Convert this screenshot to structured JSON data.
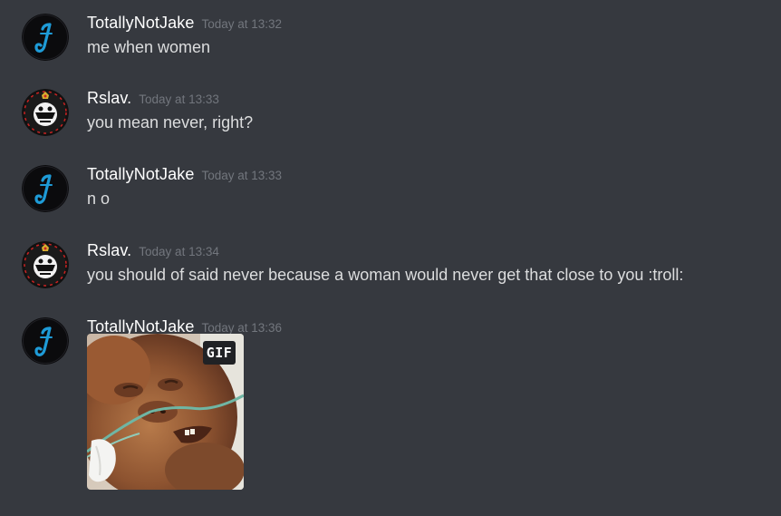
{
  "messages": [
    {
      "author": "TotallyNotJake",
      "avatar_icon": "blue-j-letter-avatar",
      "timestamp": "Today at 13:32",
      "content": "me when women"
    },
    {
      "author": "Rslav.",
      "avatar_icon": "black-white-emblem-avatar",
      "timestamp": "Today at 13:33",
      "content": "you mean never, right?"
    },
    {
      "author": "TotallyNotJake",
      "avatar_icon": "blue-j-letter-avatar",
      "timestamp": "Today at 13:33",
      "content": "n o"
    },
    {
      "author": "Rslav.",
      "avatar_icon": "black-white-emblem-avatar",
      "timestamp": "Today at 13:34",
      "content": "you should of said never because a woman would never get that close to you :troll:"
    },
    {
      "author": "TotallyNotJake",
      "avatar_icon": "blue-j-letter-avatar",
      "timestamp": "Today at 13:36",
      "attachment": {
        "type": "gif",
        "badge": "GIF"
      }
    }
  ],
  "colors": {
    "background": "#36393f",
    "username": "#ffffff",
    "timestamp": "#72767d",
    "message_text": "#dcddde",
    "j_avatar_blue": "#1e9bd7"
  }
}
